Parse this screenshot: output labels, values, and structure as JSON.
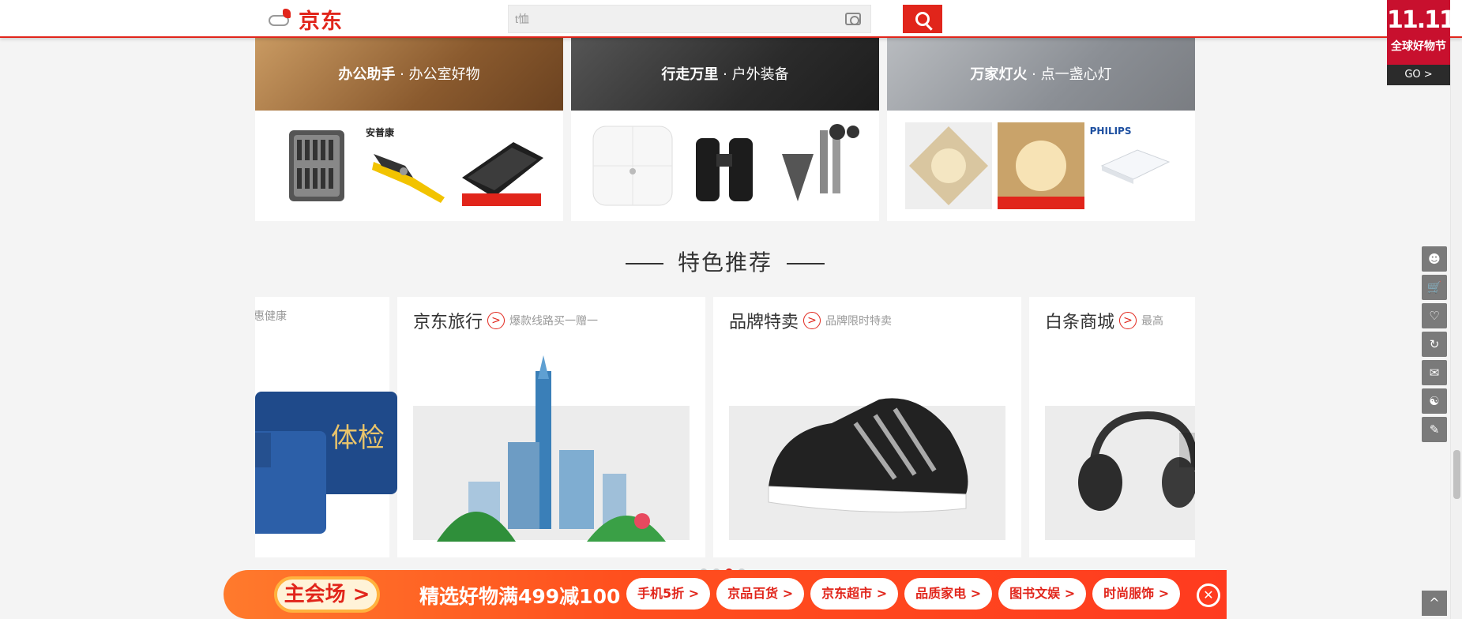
{
  "header": {
    "logo_text": "京东",
    "search_value": "t恤",
    "search_button": "search"
  },
  "promo_badge": {
    "number": "11.11",
    "label": "全球好物节",
    "go": "GO >"
  },
  "categories": [
    {
      "bold": "办公助手",
      "rest": " · 办公室好物",
      "brand": "安普康",
      "colors": [
        "#b78a5a",
        "#8f5a2b"
      ]
    },
    {
      "bold": "行走万里",
      "rest": " · 户外装备",
      "brand": "",
      "colors": [
        "#444",
        "#222"
      ]
    },
    {
      "bold": "万家灯火",
      "rest": " · 点一盏心灯",
      "brand": "PHILIPS",
      "colors": [
        "#a7aab0",
        "#8e9095"
      ]
    }
  ],
  "section_title": "特色推荐",
  "features": [
    {
      "name": "",
      "sub": "惠健康"
    },
    {
      "name": "京东旅行",
      "sub": "爆款线路买一赠一"
    },
    {
      "name": "品牌特卖",
      "sub": "品牌限时特卖"
    },
    {
      "name": "白条商城",
      "sub": "最高"
    }
  ],
  "promo_bar": {
    "main": "主会场",
    "slogan": "精选好物满499减100",
    "links": [
      "手机5折",
      "京品百货",
      "京东超市",
      "品质家电",
      "图书文娱",
      "时尚服饰"
    ]
  },
  "toolbar": {
    "items": [
      "user-icon",
      "cart-icon",
      "heart-icon",
      "history-icon",
      "message-icon",
      "service-icon",
      "edit-icon"
    ],
    "to_top": "^"
  }
}
